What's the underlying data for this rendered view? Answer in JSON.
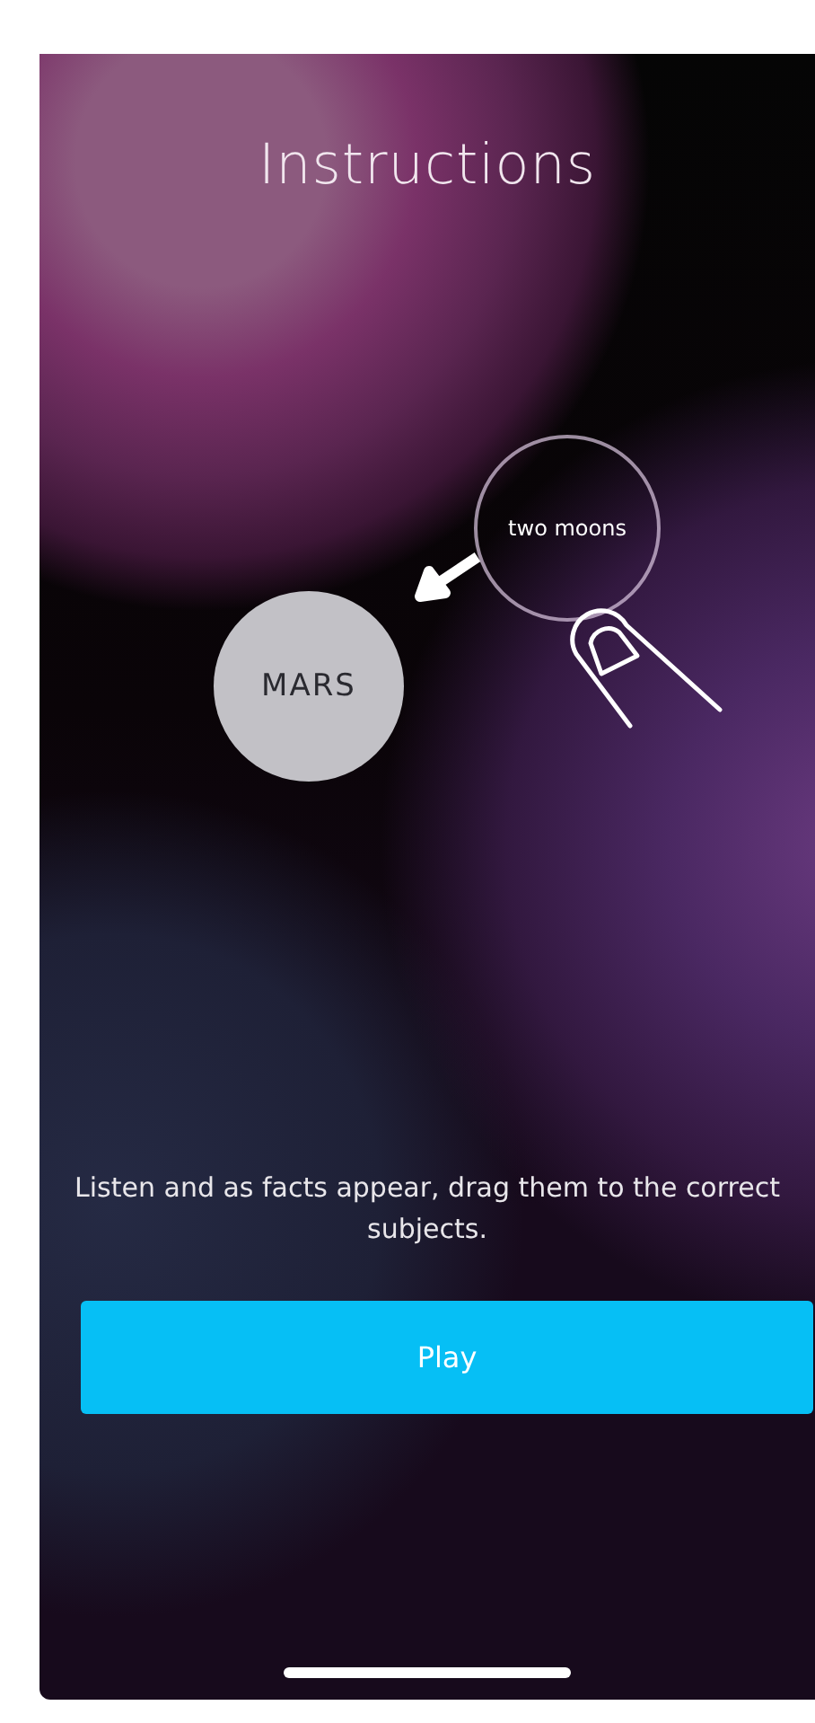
{
  "title": "Instructions",
  "demo": {
    "subject": "MARS",
    "fact": "two moons"
  },
  "instruction": "Listen and as facts appear, drag them to the correct subjects.",
  "play_button": {
    "label": "Play"
  }
}
